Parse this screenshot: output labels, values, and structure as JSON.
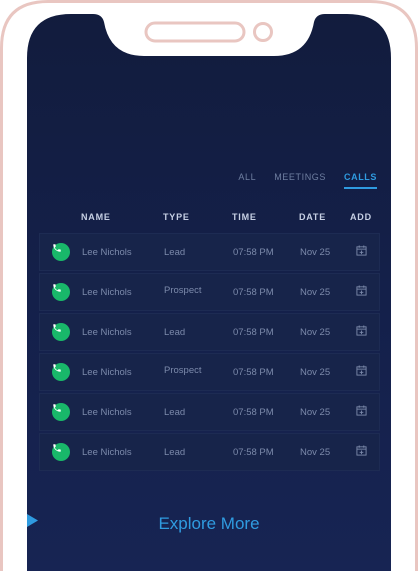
{
  "tabs": [
    {
      "label": "ALL",
      "active": false
    },
    {
      "label": "MEETINGS",
      "active": false
    },
    {
      "label": "CALLS",
      "active": true
    }
  ],
  "columns": {
    "name": "NAME",
    "type": "TYPE",
    "time": "TIME",
    "date": "DATE",
    "add": "ADD"
  },
  "rows": [
    {
      "name": "Lee Nichols",
      "type": "Lead",
      "time": "07:58 PM",
      "date": "Nov 25"
    },
    {
      "name": "Lee Nichols",
      "type": "Prospect",
      "time": "07:58 PM",
      "date": "Nov 25"
    },
    {
      "name": "Lee Nichols",
      "type": "Lead",
      "time": "07:58 PM",
      "date": "Nov 25"
    },
    {
      "name": "Lee Nichols",
      "type": "Prospect",
      "time": "07:58 PM",
      "date": "Nov 25"
    },
    {
      "name": "Lee Nichols",
      "type": "Lead",
      "time": "07:58 PM",
      "date": "Nov 25"
    },
    {
      "name": "Lee Nichols",
      "type": "Lead",
      "time": "07:58 PM",
      "date": "Nov 25"
    }
  ],
  "cta": {
    "label": "Explore More"
  },
  "colors": {
    "screen_bg": "#141f42",
    "accent": "#2f9be0",
    "phone_green": "#19b86a",
    "frame": "#e9c6c1"
  }
}
